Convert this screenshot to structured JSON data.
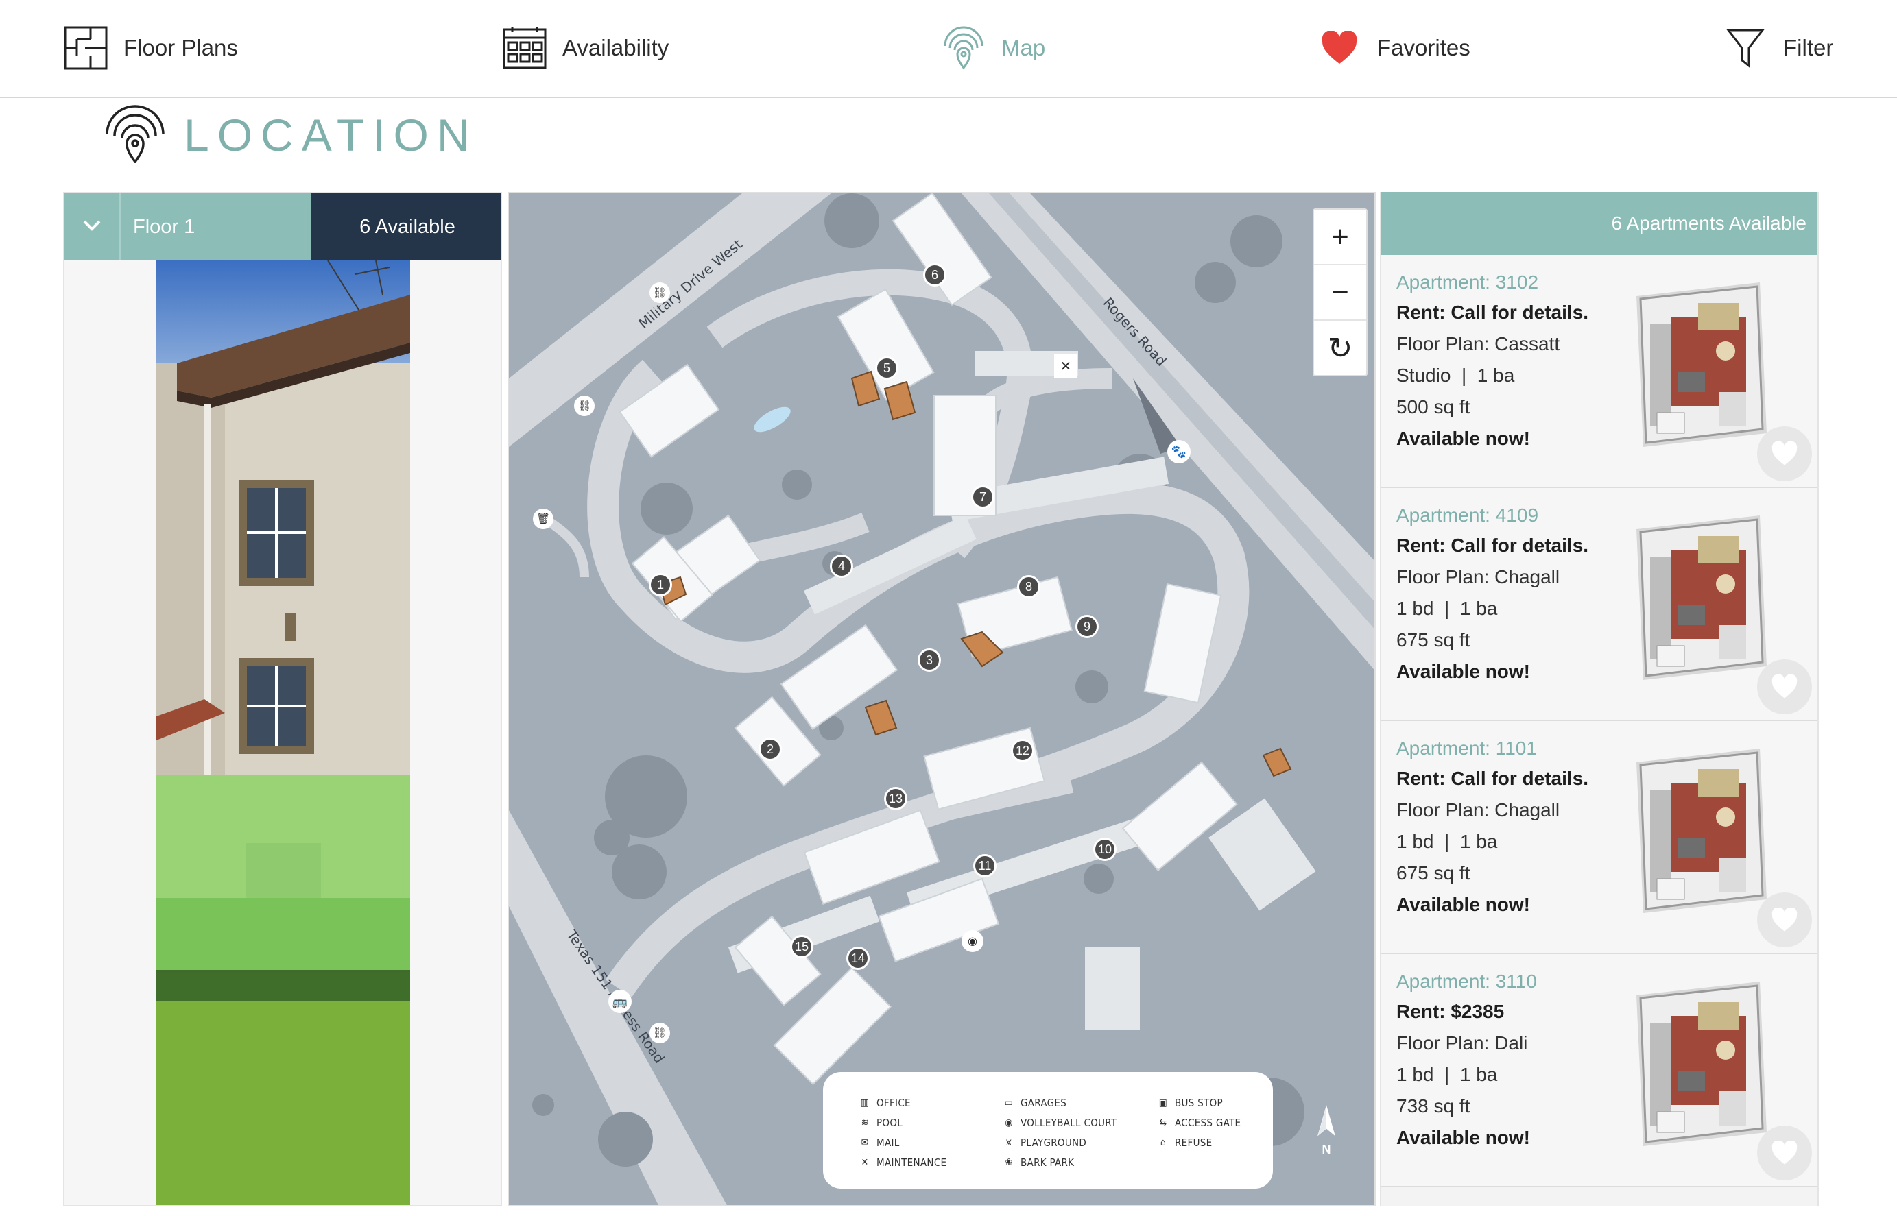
{
  "nav": {
    "items": [
      {
        "label": "Floor Plans",
        "icon": "floor-plan-icon"
      },
      {
        "label": "Availability",
        "icon": "calendar-grid-icon"
      },
      {
        "label": "Map",
        "icon": "location-pin-icon",
        "active": true
      },
      {
        "label": "Favorites",
        "icon": "heart-icon"
      },
      {
        "label": "Filter",
        "icon": "filter-funnel-icon"
      }
    ]
  },
  "page": {
    "title": "LOCATION",
    "title_icon": "location-pin-icon"
  },
  "floor_selector": {
    "floor_label": "Floor 1",
    "available_label": "6 Available"
  },
  "map": {
    "zoom_in": "+",
    "zoom_out": "−",
    "reset": "↻",
    "roads": {
      "road1": "Military Drive West",
      "road2": "Rogers Road",
      "road3": "Texas 151 Access Road"
    },
    "buildings": [
      "1",
      "2",
      "3",
      "4",
      "5",
      "6",
      "7",
      "8",
      "9",
      "10",
      "11",
      "12",
      "13",
      "14",
      "15"
    ],
    "compass_label": "N",
    "legend": [
      {
        "label": "OFFICE",
        "icon": "office-icon"
      },
      {
        "label": "GARAGES",
        "icon": "garage-icon"
      },
      {
        "label": "BUS STOP",
        "icon": "bus-icon"
      },
      {
        "label": "POOL",
        "icon": "pool-icon"
      },
      {
        "label": "VOLLEYBALL COURT",
        "icon": "volleyball-icon"
      },
      {
        "label": "ACCESS GATE",
        "icon": "gate-icon"
      },
      {
        "label": "MAIL",
        "icon": "mail-icon"
      },
      {
        "label": "PLAYGROUND",
        "icon": "playground-icon"
      },
      {
        "label": "REFUSE",
        "icon": "trash-icon"
      },
      {
        "label": "MAINTENANCE",
        "icon": "maintenance-icon"
      },
      {
        "label": "BARK PARK",
        "icon": "paw-icon"
      }
    ]
  },
  "listings": {
    "header": "6 Apartments Available",
    "apartments": [
      {
        "number": "Apartment: 3102",
        "rent": "Rent: Call for details.",
        "plan": "Floor Plan: Cassatt",
        "beds_baths": "Studio  |  1 ba",
        "sqft": "500 sq ft",
        "status": "Available now!"
      },
      {
        "number": "Apartment: 4109",
        "rent": "Rent: Call for details.",
        "plan": "Floor Plan: Chagall",
        "beds_baths": "1 bd  |  1 ba",
        "sqft": "675 sq ft",
        "status": "Available now!"
      },
      {
        "number": "Apartment: 1101",
        "rent": "Rent: Call for details.",
        "plan": "Floor Plan: Chagall",
        "beds_baths": "1 bd  |  1 ba",
        "sqft": "675 sq ft",
        "status": "Available now!"
      },
      {
        "number": "Apartment: 3110",
        "rent": "Rent: $2385",
        "plan": "Floor Plan: Dali",
        "beds_baths": "1 bd  |  1 ba",
        "sqft": "738 sq ft",
        "status": "Available now!"
      }
    ]
  },
  "colors": {
    "accent_teal": "#8cbdb7",
    "teal_text": "#7fb0ab",
    "navy": "#24354a",
    "map_bg": "#a3adb8",
    "heart_red": "#e8413c",
    "highlight_unit": "#c9874f",
    "floor_highlight": "#8fe06a"
  }
}
